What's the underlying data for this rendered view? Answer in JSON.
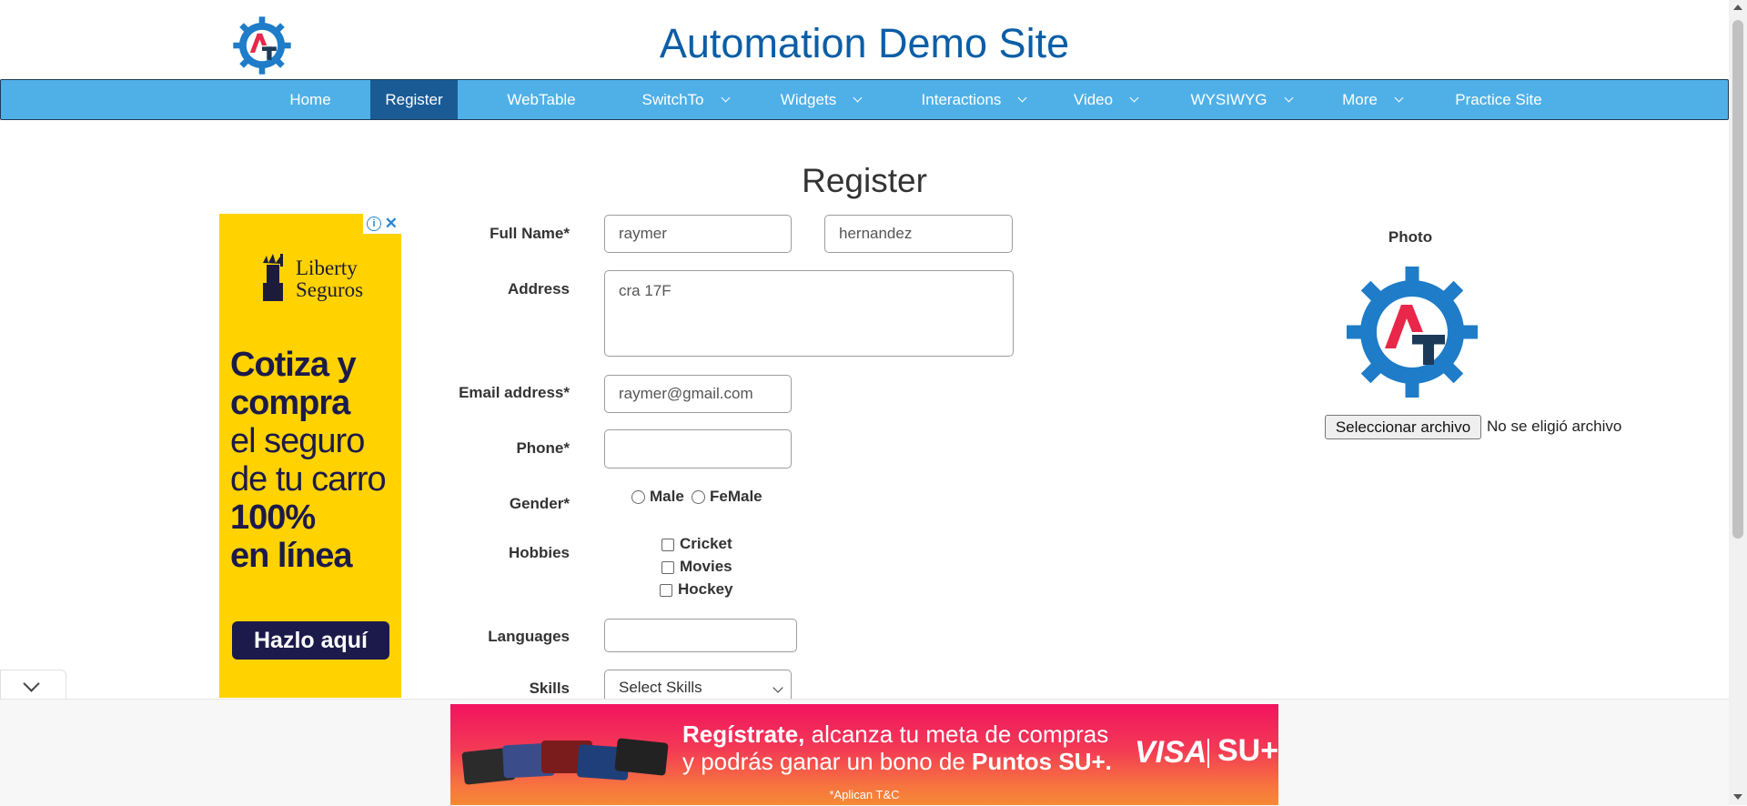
{
  "header": {
    "title": "Automation Demo Site"
  },
  "nav": {
    "items": [
      {
        "label": "Home"
      },
      {
        "label": "Register"
      },
      {
        "label": "WebTable"
      },
      {
        "label": "SwitchTo"
      },
      {
        "label": "Widgets"
      },
      {
        "label": "Interactions"
      },
      {
        "label": "Video"
      },
      {
        "label": "WYSIWYG"
      },
      {
        "label": "More"
      },
      {
        "label": "Practice Site"
      }
    ]
  },
  "page": {
    "title": "Register"
  },
  "form": {
    "full_name_label": "Full Name*",
    "first_name_value": "raymer",
    "last_name_value": "hernandez",
    "address_label": "Address",
    "address_value": "cra 17F",
    "email_label": "Email address*",
    "email_value": "raymer@gmail.com",
    "phone_label": "Phone*",
    "phone_value": "",
    "gender_label": "Gender*",
    "gender_options": [
      "Male",
      "FeMale"
    ],
    "hobbies_label": "Hobbies",
    "hobbies_options": [
      "Cricket",
      "Movies",
      "Hockey"
    ],
    "languages_label": "Languages",
    "skills_label": "Skills",
    "skills_selected": "Select Skills"
  },
  "photo": {
    "label": "Photo",
    "file_button": "Seleccionar archivo",
    "file_status": "No se eligió archivo"
  },
  "ad_left": {
    "brand_line1": "Liberty",
    "brand_line2": "Seguros",
    "line1": "Cotiza y",
    "line2": "compra",
    "line3": "el seguro",
    "line4": "de tu carro",
    "line5": "100%",
    "line6": "en línea",
    "cta": "Hazlo aquí",
    "color": "#ffd200"
  },
  "ad_bottom": {
    "line1_bold": "Regístrate,",
    "line1_rest": " alcanza tu meta de compras",
    "line2_start": "y podrás ganar un bono de ",
    "line2_bold": "Puntos SU+.",
    "brand_visa": "VISA",
    "brand_su": "SU+",
    "terms": "*Aplican T&C"
  },
  "colors": {
    "nav_bg": "#4fb0e8",
    "nav_active": "#1a5b96",
    "title": "#0b5ea6",
    "logo_blue": "#1e7cc8",
    "logo_red": "#e8274a",
    "logo_dark": "#1b3a57"
  }
}
